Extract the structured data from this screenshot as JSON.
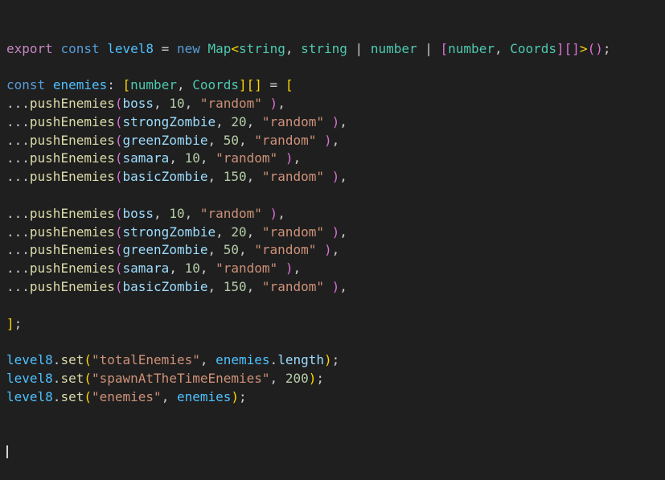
{
  "editor": {
    "lines": [
      [
        [
          "kw",
          "export"
        ],
        [
          "pun",
          " "
        ],
        [
          "dec",
          "const"
        ],
        [
          "pun",
          " "
        ],
        [
          "var",
          "level8"
        ],
        [
          "pun",
          " = "
        ],
        [
          "dec",
          "new"
        ],
        [
          "pun",
          " "
        ],
        [
          "type",
          "Map"
        ],
        [
          "bgold",
          "<"
        ],
        [
          "type",
          "string"
        ],
        [
          "pun",
          ", "
        ],
        [
          "type",
          "string"
        ],
        [
          "pun",
          " | "
        ],
        [
          "type",
          "number"
        ],
        [
          "pun",
          " | "
        ],
        [
          "bpurp",
          "["
        ],
        [
          "type",
          "number"
        ],
        [
          "pun",
          ", "
        ],
        [
          "type",
          "Coords"
        ],
        [
          "bpurp",
          "]"
        ],
        [
          "bpurp",
          "[]"
        ],
        [
          "bgold",
          ">"
        ],
        [
          "bpurp",
          "()"
        ],
        [
          "pun",
          ";"
        ]
      ],
      [],
      [
        [
          "dec",
          "const"
        ],
        [
          "pun",
          " "
        ],
        [
          "var",
          "enemies"
        ],
        [
          "pun",
          ": "
        ],
        [
          "bgold",
          "["
        ],
        [
          "type",
          "number"
        ],
        [
          "pun",
          ", "
        ],
        [
          "type",
          "Coords"
        ],
        [
          "bgold",
          "]"
        ],
        [
          "bgold",
          "[]"
        ],
        [
          "pun",
          " = "
        ],
        [
          "bgold",
          "["
        ]
      ],
      [
        [
          "pun",
          "..."
        ],
        [
          "fn",
          "pushEnemies"
        ],
        [
          "bpurp",
          "("
        ],
        [
          "prop",
          "boss"
        ],
        [
          "pun",
          ", "
        ],
        [
          "num",
          "10"
        ],
        [
          "pun",
          ", "
        ],
        [
          "str",
          "\"random\""
        ],
        [
          "pun",
          " "
        ],
        [
          "bpurp",
          ")"
        ],
        [
          "pun",
          ","
        ]
      ],
      [
        [
          "pun",
          "..."
        ],
        [
          "fn",
          "pushEnemies"
        ],
        [
          "bpurp",
          "("
        ],
        [
          "prop",
          "strongZombie"
        ],
        [
          "pun",
          ", "
        ],
        [
          "num",
          "20"
        ],
        [
          "pun",
          ", "
        ],
        [
          "str",
          "\"random\""
        ],
        [
          "pun",
          " "
        ],
        [
          "bpurp",
          ")"
        ],
        [
          "pun",
          ","
        ]
      ],
      [
        [
          "pun",
          "..."
        ],
        [
          "fn",
          "pushEnemies"
        ],
        [
          "bpurp",
          "("
        ],
        [
          "prop",
          "greenZombie"
        ],
        [
          "pun",
          ", "
        ],
        [
          "num",
          "50"
        ],
        [
          "pun",
          ", "
        ],
        [
          "str",
          "\"random\""
        ],
        [
          "pun",
          " "
        ],
        [
          "bpurp",
          ")"
        ],
        [
          "pun",
          ","
        ]
      ],
      [
        [
          "pun",
          "..."
        ],
        [
          "fn",
          "pushEnemies"
        ],
        [
          "bpurp",
          "("
        ],
        [
          "prop",
          "samara"
        ],
        [
          "pun",
          ", "
        ],
        [
          "num",
          "10"
        ],
        [
          "pun",
          ", "
        ],
        [
          "str",
          "\"random\""
        ],
        [
          "pun",
          " "
        ],
        [
          "bpurp",
          ")"
        ],
        [
          "pun",
          ","
        ]
      ],
      [
        [
          "pun",
          "..."
        ],
        [
          "fn",
          "pushEnemies"
        ],
        [
          "bpurp",
          "("
        ],
        [
          "prop",
          "basicZombie"
        ],
        [
          "pun",
          ", "
        ],
        [
          "num",
          "150"
        ],
        [
          "pun",
          ", "
        ],
        [
          "str",
          "\"random\""
        ],
        [
          "pun",
          " "
        ],
        [
          "bpurp",
          ")"
        ],
        [
          "pun",
          ","
        ]
      ],
      [],
      [
        [
          "pun",
          "..."
        ],
        [
          "fn",
          "pushEnemies"
        ],
        [
          "bpurp",
          "("
        ],
        [
          "prop",
          "boss"
        ],
        [
          "pun",
          ", "
        ],
        [
          "num",
          "10"
        ],
        [
          "pun",
          ", "
        ],
        [
          "str",
          "\"random\""
        ],
        [
          "pun",
          " "
        ],
        [
          "bpurp",
          ")"
        ],
        [
          "pun",
          ","
        ]
      ],
      [
        [
          "pun",
          "..."
        ],
        [
          "fn",
          "pushEnemies"
        ],
        [
          "bpurp",
          "("
        ],
        [
          "prop",
          "strongZombie"
        ],
        [
          "pun",
          ", "
        ],
        [
          "num",
          "20"
        ],
        [
          "pun",
          ", "
        ],
        [
          "str",
          "\"random\""
        ],
        [
          "pun",
          " "
        ],
        [
          "bpurp",
          ")"
        ],
        [
          "pun",
          ","
        ]
      ],
      [
        [
          "pun",
          "..."
        ],
        [
          "fn",
          "pushEnemies"
        ],
        [
          "bpurp",
          "("
        ],
        [
          "prop",
          "greenZombie"
        ],
        [
          "pun",
          ", "
        ],
        [
          "num",
          "50"
        ],
        [
          "pun",
          ", "
        ],
        [
          "str",
          "\"random\""
        ],
        [
          "pun",
          " "
        ],
        [
          "bpurp",
          ")"
        ],
        [
          "pun",
          ","
        ]
      ],
      [
        [
          "pun",
          "..."
        ],
        [
          "fn",
          "pushEnemies"
        ],
        [
          "bpurp",
          "("
        ],
        [
          "prop",
          "samara"
        ],
        [
          "pun",
          ", "
        ],
        [
          "num",
          "10"
        ],
        [
          "pun",
          ", "
        ],
        [
          "str",
          "\"random\""
        ],
        [
          "pun",
          " "
        ],
        [
          "bpurp",
          ")"
        ],
        [
          "pun",
          ","
        ]
      ],
      [
        [
          "pun",
          "..."
        ],
        [
          "fn",
          "pushEnemies"
        ],
        [
          "bpurp",
          "("
        ],
        [
          "prop",
          "basicZombie"
        ],
        [
          "pun",
          ", "
        ],
        [
          "num",
          "150"
        ],
        [
          "pun",
          ", "
        ],
        [
          "str",
          "\"random\""
        ],
        [
          "pun",
          " "
        ],
        [
          "bpurp",
          ")"
        ],
        [
          "pun",
          ","
        ]
      ],
      [],
      [
        [
          "bgold",
          "]"
        ],
        [
          "pun",
          ";"
        ]
      ],
      [],
      [
        [
          "var",
          "level8"
        ],
        [
          "pun",
          "."
        ],
        [
          "fn",
          "set"
        ],
        [
          "bgold",
          "("
        ],
        [
          "str",
          "\"totalEnemies\""
        ],
        [
          "pun",
          ", "
        ],
        [
          "var",
          "enemies"
        ],
        [
          "pun",
          "."
        ],
        [
          "prop",
          "length"
        ],
        [
          "bgold",
          ")"
        ],
        [
          "pun",
          ";"
        ]
      ],
      [
        [
          "var",
          "level8"
        ],
        [
          "pun",
          "."
        ],
        [
          "fn",
          "set"
        ],
        [
          "bgold",
          "("
        ],
        [
          "str",
          "\"spawnAtTheTimeEnemies\""
        ],
        [
          "pun",
          ", "
        ],
        [
          "num",
          "200"
        ],
        [
          "bgold",
          ")"
        ],
        [
          "pun",
          ";"
        ]
      ],
      [
        [
          "var",
          "level8"
        ],
        [
          "pun",
          "."
        ],
        [
          "fn",
          "set"
        ],
        [
          "bgold",
          "("
        ],
        [
          "str",
          "\"enemies\""
        ],
        [
          "pun",
          ", "
        ],
        [
          "var",
          "enemies"
        ],
        [
          "bgold",
          ")"
        ],
        [
          "pun",
          ";"
        ]
      ]
    ]
  },
  "colors": {
    "background": "#1f1f1f",
    "keyword": "#c586c0",
    "declaration": "#569cd6",
    "variable": "#4fc1ff",
    "function": "#dcdcaa",
    "type": "#4ec9b0",
    "string": "#ce9178",
    "number": "#b5cea8",
    "property": "#9cdcfe",
    "punctuation": "#cccccc",
    "bracket_level1": "#ffd700",
    "bracket_level2": "#da70d6"
  }
}
